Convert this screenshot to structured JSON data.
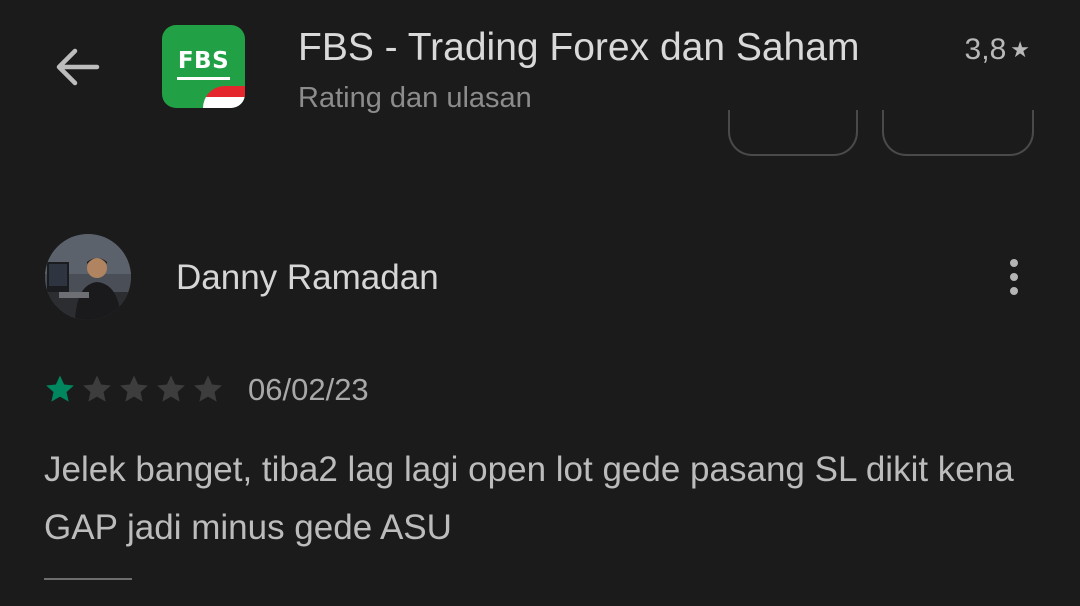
{
  "header": {
    "back_icon": "arrow-left-icon",
    "app_icon": {
      "logo_text": "FBS",
      "brand_color": "#22a046",
      "flag_colors": [
        "#e3272d",
        "#ffffff"
      ]
    },
    "app_title": "FBS - Trading Forex dan Saham",
    "rating_value": "3,8",
    "rating_star": "★",
    "subtitle": "Rating dan ulasan"
  },
  "review": {
    "reviewer_name": "Danny Ramadan",
    "avatar_icon": "user-avatar-photo",
    "more_icon": "more-vertical-icon",
    "rating": 1,
    "max_rating": 5,
    "star_active_color": "#01875f",
    "star_inactive_color": "#3d3d3d",
    "date": "06/02/23",
    "text": "Jelek banget, tiba2 lag lagi open lot gede pasang SL dikit kena GAP jadi minus gede ASU"
  }
}
